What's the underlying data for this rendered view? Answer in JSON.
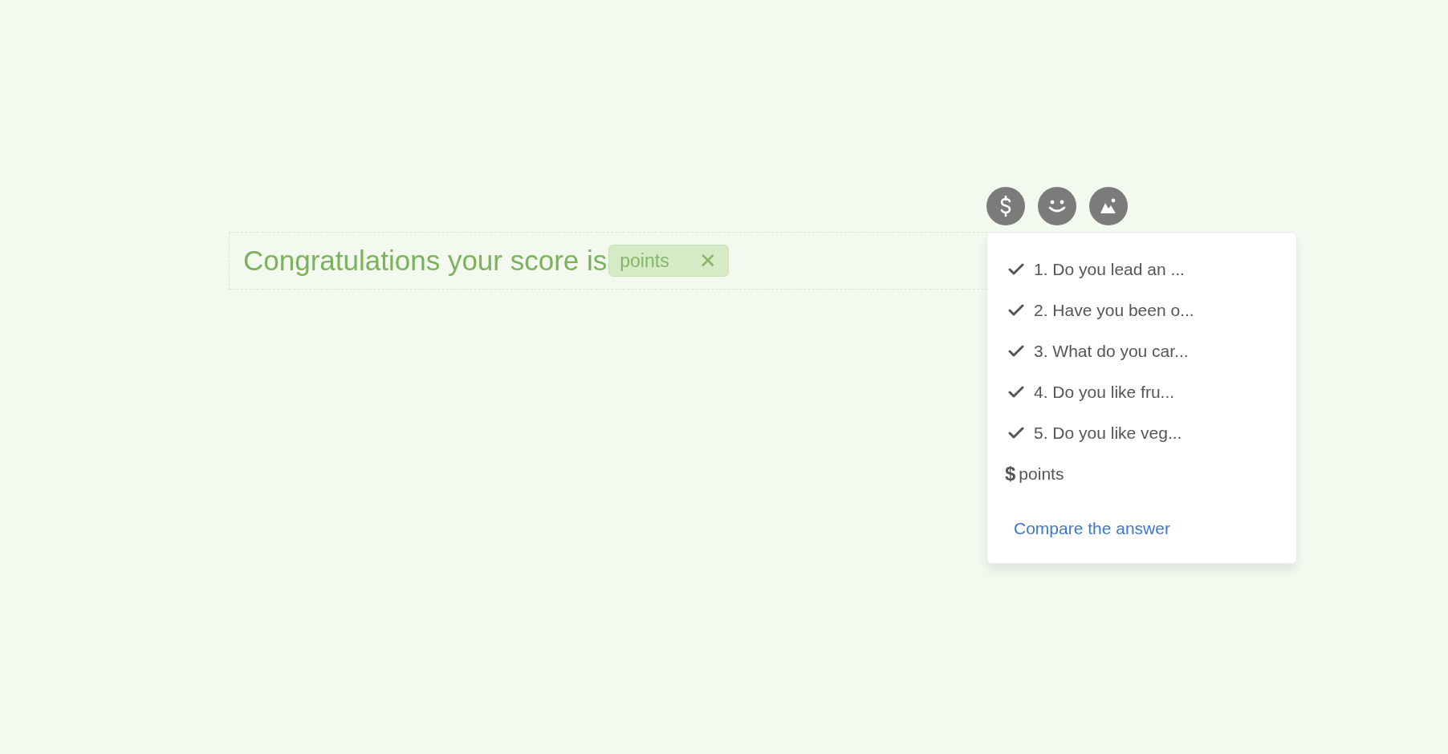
{
  "editor": {
    "text": "Congratulations your score is",
    "chip": {
      "label": "points",
      "remove": "✕"
    }
  },
  "toolbar": [
    {
      "kind": "dollar"
    },
    {
      "kind": "smiley"
    },
    {
      "kind": "image"
    }
  ],
  "menu": {
    "items": [
      {
        "kind": "question",
        "label": "1. Do you lead an ...",
        "checked": true
      },
      {
        "kind": "question",
        "label": "2. Have you been o...",
        "checked": true
      },
      {
        "kind": "question",
        "label": "3. What do you car...",
        "checked": true
      },
      {
        "kind": "question",
        "label": "4. Do you like fru...",
        "checked": true
      },
      {
        "kind": "question",
        "label": "5. Do you like veg...",
        "checked": true
      },
      {
        "kind": "variable",
        "symbol": "$",
        "label": "points"
      }
    ],
    "link": "Compare the answer"
  }
}
